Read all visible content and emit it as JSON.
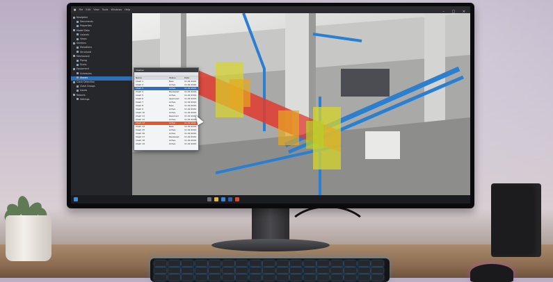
{
  "app": {
    "menu": [
      "File",
      "Edit",
      "View",
      "Tools",
      "Windows",
      "Help"
    ],
    "window_controls": [
      "–",
      "□",
      "×"
    ]
  },
  "sidebar": {
    "items": [
      {
        "label": "Navigator"
      },
      {
        "label": "Documents"
      },
      {
        "label": "Properties"
      },
      {
        "label": "Model Data"
      },
      {
        "label": "Layouts"
      },
      {
        "label": "Views"
      },
      {
        "label": "Sections"
      },
      {
        "label": "Elevations"
      },
      {
        "label": "Structural"
      },
      {
        "label": "Mechanical"
      },
      {
        "label": "Piping"
      },
      {
        "label": "Ducts"
      },
      {
        "label": "Equipment"
      },
      {
        "label": "Schedules"
      },
      {
        "label": "Sheets"
      },
      {
        "label": "Clash Detection"
      },
      {
        "label": "Clash Groups"
      },
      {
        "label": "Issues"
      },
      {
        "label": "Reports"
      },
      {
        "label": "Settings"
      }
    ],
    "selected_index": 14
  },
  "clash_panel": {
    "title": "Clashes",
    "columns": [
      "Name",
      "Status",
      "Date"
    ],
    "rows": [
      {
        "name": "Clash 1",
        "status": "New",
        "date": "11.02.2024"
      },
      {
        "name": "Clash 2",
        "status": "Active",
        "date": "11.02.2024"
      },
      {
        "name": "Clash 3",
        "status": "Active",
        "date": "11.02.2024"
      },
      {
        "name": "Clash 4",
        "status": "Reviewed",
        "date": "11.02.2024"
      },
      {
        "name": "Clash 5",
        "status": "Active",
        "date": "11.02.2024"
      },
      {
        "name": "Clash 6",
        "status": "Approved",
        "date": "11.02.2024"
      },
      {
        "name": "Clash 7",
        "status": "Active",
        "date": "11.02.2024"
      },
      {
        "name": "Clash 8",
        "status": "New",
        "date": "11.02.2024"
      },
      {
        "name": "Clash 9",
        "status": "Active",
        "date": "11.02.2024"
      },
      {
        "name": "Clash 10",
        "status": "Active",
        "date": "11.02.2024"
      },
      {
        "name": "Clash 11",
        "status": "Resolved",
        "date": "11.02.2024"
      },
      {
        "name": "Clash 12",
        "status": "Active",
        "date": "11.02.2024"
      },
      {
        "name": "Clash 13",
        "status": "Active",
        "date": "11.02.2024"
      },
      {
        "name": "Clash 14",
        "status": "New",
        "date": "11.02.2024"
      },
      {
        "name": "Clash 15",
        "status": "Active",
        "date": "11.02.2024"
      },
      {
        "name": "Clash 16",
        "status": "Active",
        "date": "11.02.2024"
      },
      {
        "name": "Clash 17",
        "status": "Reviewed",
        "date": "11.02.2024"
      },
      {
        "name": "Clash 18",
        "status": "Active",
        "date": "11.02.2024"
      },
      {
        "name": "Clash 19",
        "status": "Active",
        "date": "11.02.2024"
      }
    ],
    "selected_index": 2,
    "highlighted_index": 12
  },
  "colors": {
    "accent": "#2f6fb5",
    "clash_red": "#e23b2e",
    "clash_yellow": "#d8d62a",
    "pipe_blue": "#2a7fd1"
  },
  "icons": [
    "start-icon",
    "search-icon",
    "folder-icon",
    "browser-icon",
    "mail-icon",
    "app-icon"
  ]
}
